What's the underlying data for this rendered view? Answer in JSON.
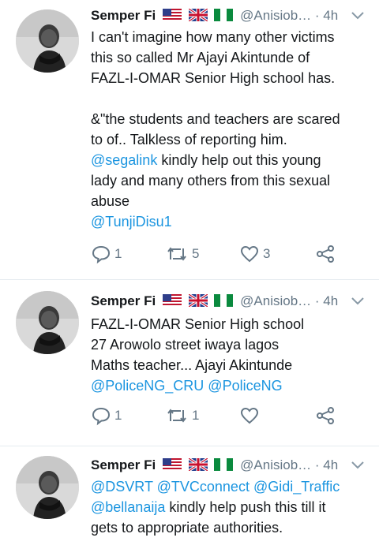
{
  "tweets": [
    {
      "name": "Semper Fi",
      "flags": [
        "us-flag-icon",
        "uk-flag-icon",
        "nigeria-flag-icon"
      ],
      "handle": "@Anisiob…",
      "dot": "·",
      "time": "4h",
      "lines": [
        "I can't imagine how many other victims",
        "this so called Mr Ajayi Akintunde of",
        "FAZL-I-OMAR Senior High school has.",
        "",
        "&\"the students and teachers are scared",
        "to of.. Talkless of reporting him."
      ],
      "mention1": "@segalink",
      "mention1_rest": " kindly help out this young",
      "lines2": [
        "lady and many others from this sexual",
        "abuse"
      ],
      "mention2": "@TunjiDisu1",
      "replies": "1",
      "retweets": "5",
      "likes": "3"
    },
    {
      "name": "Semper Fi",
      "flags": [
        "us-flag-icon",
        "uk-flag-icon",
        "nigeria-flag-icon"
      ],
      "handle": "@Anisiob…",
      "dot": "·",
      "time": "4h",
      "lines": [
        "FAZL-I-OMAR Senior High school",
        "27 Arowolo street iwaya lagos",
        "Maths teacher... Ajayi Akintunde"
      ],
      "mentions": "@PoliceNG_CRU @PoliceNG",
      "replies": "1",
      "retweets": "1",
      "likes": ""
    },
    {
      "name": "Semper Fi",
      "flags": [
        "us-flag-icon",
        "uk-flag-icon",
        "nigeria-flag-icon"
      ],
      "handle": "@Anisiob…",
      "dot": "·",
      "time": "4h",
      "mentions": "@DSVRT @TVCconnect @Gidi_Traffic",
      "mention_b": "@bellanaija",
      "rest": " kindly help push this till it",
      "lines": [
        "gets to appropriate authorities."
      ]
    }
  ],
  "colors": {
    "link": "#1b95e0",
    "secondary": "#657786",
    "divider": "#e6ecf0"
  }
}
